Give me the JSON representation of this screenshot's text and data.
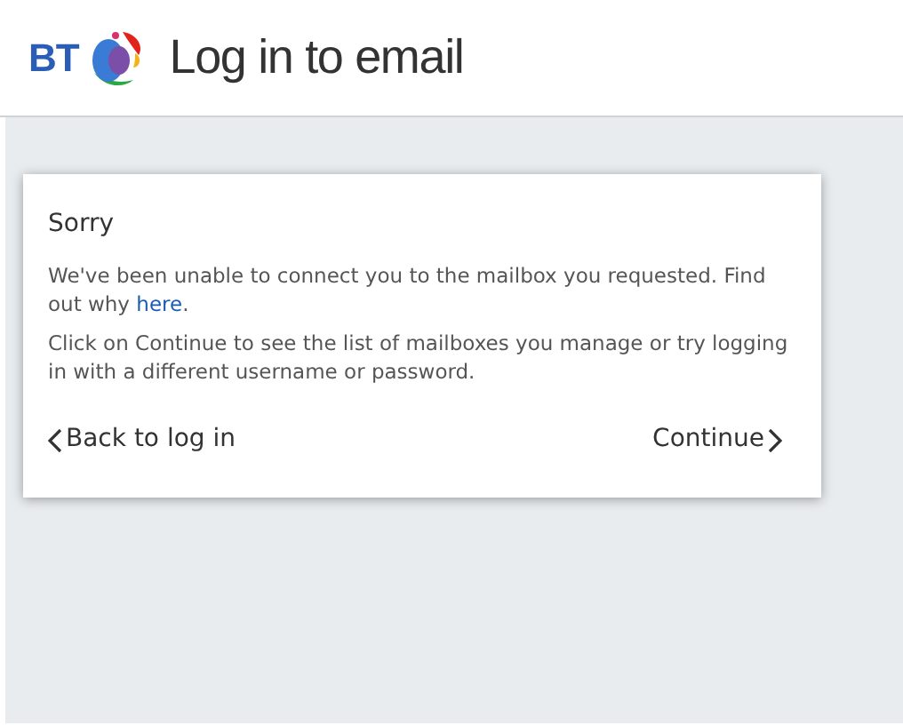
{
  "header": {
    "logo_text": "BT",
    "title": "Log in to email"
  },
  "dialog": {
    "title": "Sorry",
    "message": {
      "before": "We've been unable to connect you to the mailbox you requested. Find out why ",
      "link": "here",
      "after": "."
    },
    "instructions": "Click on Continue to see the list of mailboxes you manage or try logging in with a different username or password.",
    "back_link": "Back to log in",
    "continue_link": "Continue"
  }
}
